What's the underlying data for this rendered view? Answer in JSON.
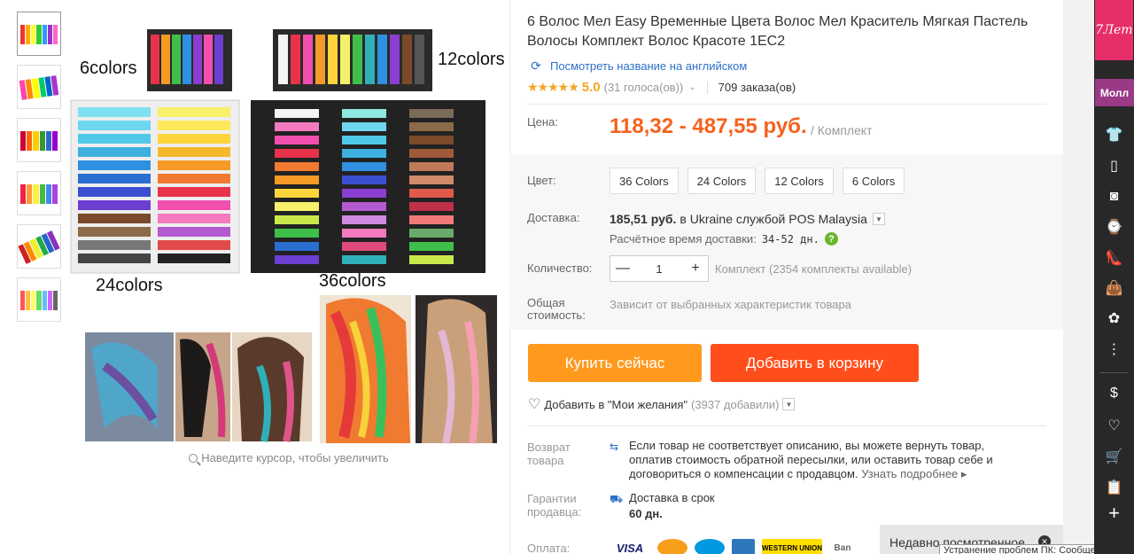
{
  "product": {
    "title": "6 Волос Мел Easy Временные Цвета Волос Мел Краситель Мягкая Пастель Волосы Комплект Волос Красоте 1ЕС2",
    "translate_link": "Посмотреть название на английском",
    "stars": "★★★★★",
    "score": "5.0",
    "votes": "(31 голоса(ов))",
    "orders": "709 заказа(ов)"
  },
  "image": {
    "label_6": "6colors",
    "label_12": "12colors",
    "label_24": "24colors",
    "label_36": "36colors",
    "zoom_hint": "Наведите курсор, чтобы увеличить"
  },
  "price": {
    "label": "Цена:",
    "value": "118,32 - 487,55 руб.",
    "unit": "/ Комплект"
  },
  "color": {
    "label": "Цвет:",
    "options": [
      "36 Colors",
      "24 Colors",
      "12 Colors",
      "6 Colors"
    ]
  },
  "shipping": {
    "label": "Доставка:",
    "cost": "185,51 руб.",
    "text": "в Ukraine службой POS Malaysia",
    "est_label": "Расчётное время доставки:",
    "est_days": "34-52 дн.",
    "help": "?"
  },
  "quantity": {
    "label": "Количество:",
    "value": "1",
    "minus": "—",
    "plus": "+",
    "note": "Комплект (2354 комплекты available)"
  },
  "total": {
    "label": "Общая стоимость:",
    "value": "Зависит от выбранных характеристик товара"
  },
  "buttons": {
    "buy_now": "Купить сейчас",
    "add_cart": "Добавить в корзину"
  },
  "wishlist": {
    "label": "Добавить в \"Мои желания\"",
    "count": "(3937 добавили)"
  },
  "returns": {
    "label": "Возврат товара",
    "text": "Если товар не соответствует описанию, вы можете вернуть товар, оплатив стоимость обратной пересылки, или оставить товар себе и договориться о компенсации с продавцом.",
    "more": "Узнать подробнее ▸"
  },
  "guarantee": {
    "label": "Гарантии продавца:",
    "text": "Доставка в срок",
    "days": "60 дн."
  },
  "payment": {
    "label": "Оплата:",
    "methods": [
      "VISA",
      "MC",
      "Maestro",
      "AmEx",
      "WESTERN UNION",
      "Ban"
    ]
  },
  "recent": {
    "label": "Недавно посмотренное",
    "close": "✕"
  },
  "taskbar_tip": "Устранение проблем ПК: Сообщений",
  "sidebar": {
    "logo": "7Лет",
    "mall": "Молл"
  },
  "colors": {
    "accent_orange": "#ff9a1f",
    "accent_red": "#ff4e1b",
    "price": "#f5621e",
    "link": "#2d70c9"
  }
}
